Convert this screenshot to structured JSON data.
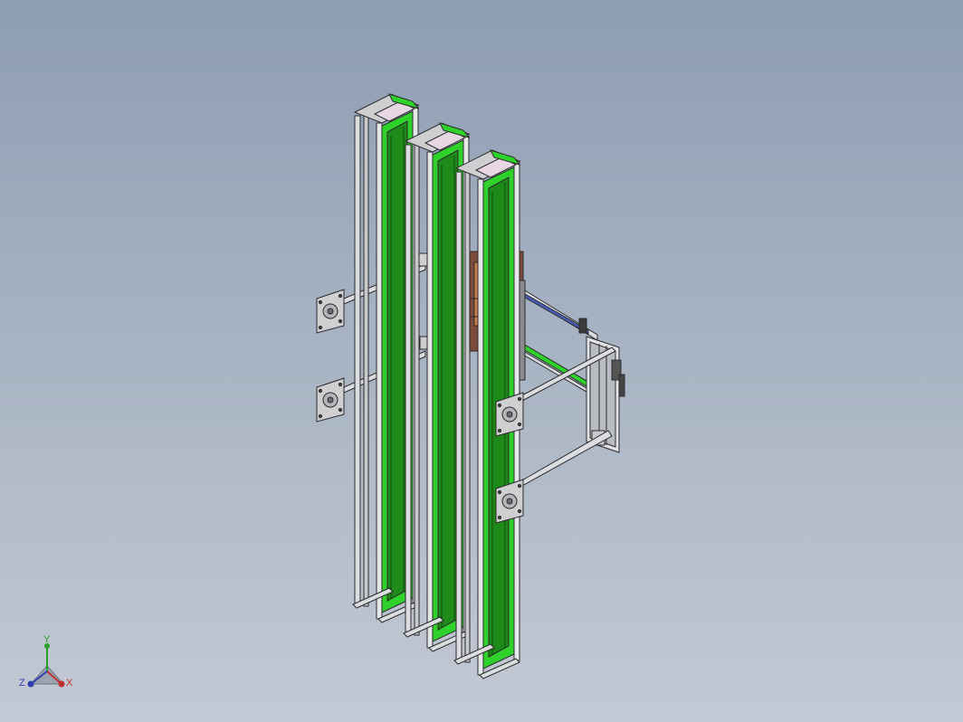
{
  "viewport": {
    "background_top": "#8d9db2",
    "background_bottom": "#c3c9d4"
  },
  "model": {
    "colors": {
      "frame": "#dcdde0",
      "frame_edge": "#2b2b2b",
      "belt": "#2fd22a",
      "belt_dark": "#1e8a1a",
      "plate": "#cfcfd2",
      "motor_body": "#7d4b3a",
      "rail_blue": "#4a5db8"
    },
    "columns": 3,
    "mount_plates": 4
  },
  "triad": {
    "x_label": "X",
    "y_label": "Y",
    "z_label": "Z",
    "x_color": "#c03030",
    "y_color": "#2aa02a",
    "z_color": "#3040b0"
  }
}
